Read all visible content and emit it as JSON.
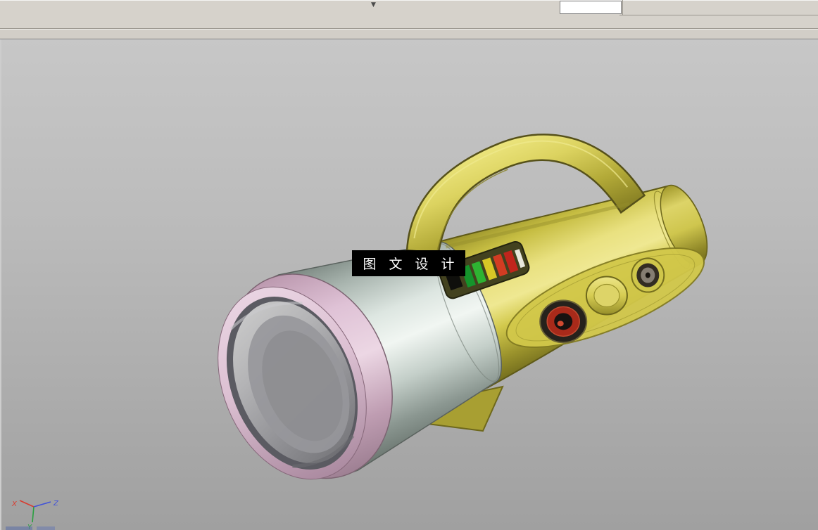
{
  "app": {
    "toolbar": {
      "dropdown_glyph": "▼",
      "textbox_value": ""
    }
  },
  "viewport": {
    "watermark": {
      "text": "图 文 设 计",
      "background": "#000000",
      "color": "#ffffff"
    },
    "triad": {
      "x": {
        "label": "X",
        "color": "#d83c30"
      },
      "y": {
        "label": "Y",
        "color": "#2aa040"
      },
      "z": {
        "label": "Z",
        "color": "#4052d8"
      }
    }
  },
  "model": {
    "name": "handheld-searchlight-3d-model",
    "colors": {
      "body": "#d8ce52",
      "handle": "#d6cc56",
      "head_cone": "#cdd8d2",
      "lens_bezel": "#dcc0d4",
      "lens": "#9a9a9e",
      "button_red": "#a82a1a",
      "knob": "#d6cc52",
      "tail": "#cfc64e"
    },
    "indicator": {
      "bars": [
        "#15932b",
        "#2eb332",
        "#d8c826",
        "#d23c22",
        "#c0251c",
        "#e8e8dc"
      ]
    }
  }
}
